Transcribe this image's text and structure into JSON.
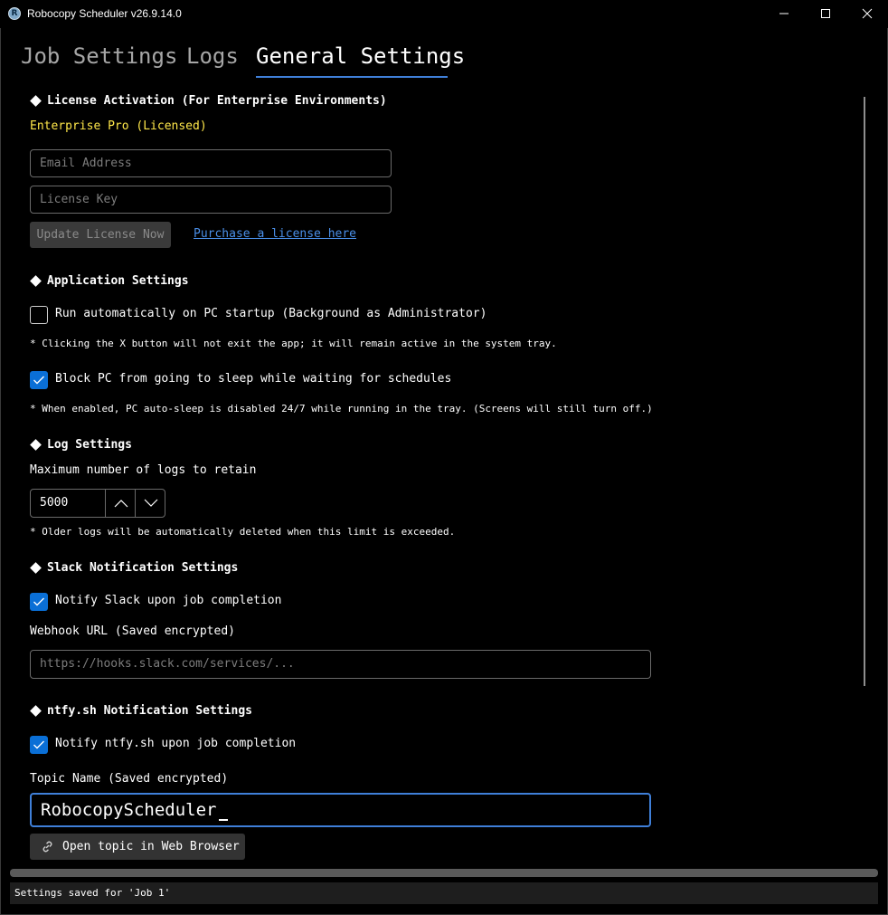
{
  "window": {
    "title": "Robocopy Scheduler v26.9.14.0",
    "app_icon_letter": "R",
    "minimize_icon": "minimize-icon",
    "maximize_icon": "maximize-icon",
    "close_icon": "close-icon"
  },
  "tabs": [
    {
      "label": "Job Settings",
      "active": false
    },
    {
      "label": "Logs",
      "active": false
    },
    {
      "label": "General Settings",
      "active": true
    }
  ],
  "license": {
    "section_title": "License Activation (For Enterprise Environments)",
    "status": "Enterprise Pro (Licensed)",
    "email_placeholder": "Email Address",
    "key_placeholder": "License Key",
    "update_button": "Update License Now",
    "purchase_link": "Purchase a license here",
    "status_color": "#ffe84a"
  },
  "application": {
    "section_title": "Application Settings",
    "startup_label": "Run automatically on PC startup (Background as Administrator)",
    "startup_checked": false,
    "startup_note": "* Clicking the X button will not exit the app; it will remain active in the system tray.",
    "sleep_label": "Block PC from going to sleep while waiting for schedules",
    "sleep_checked": true,
    "sleep_note": "* When enabled, PC auto-sleep is disabled 24/7 while running in the tray. (Screens will still turn off.)"
  },
  "logs": {
    "section_title": "Log Settings",
    "max_label": "Maximum number of logs to retain",
    "max_value": "5000",
    "note": "* Older logs will be automatically deleted when this limit is exceeded."
  },
  "slack": {
    "section_title": "Slack Notification Settings",
    "notify_label": "Notify Slack upon job completion",
    "notify_checked": true,
    "webhook_label": "Webhook URL (Saved encrypted)",
    "webhook_placeholder": "https://hooks.slack.com/services/..."
  },
  "ntfy": {
    "section_title": "ntfy.sh Notification Settings",
    "notify_label": "Notify ntfy.sh upon job completion",
    "notify_checked": true,
    "topic_label": "Topic Name (Saved encrypted)",
    "topic_value": "RobocopyScheduler",
    "open_button": "Open topic in Web Browser",
    "open_icon": "link-icon"
  },
  "status": {
    "text": "Settings saved for 'Job 1'"
  },
  "colors": {
    "accent": "#3f7fd8",
    "checkbox_on": "#0a6fd6",
    "link": "#4a8fe8"
  }
}
